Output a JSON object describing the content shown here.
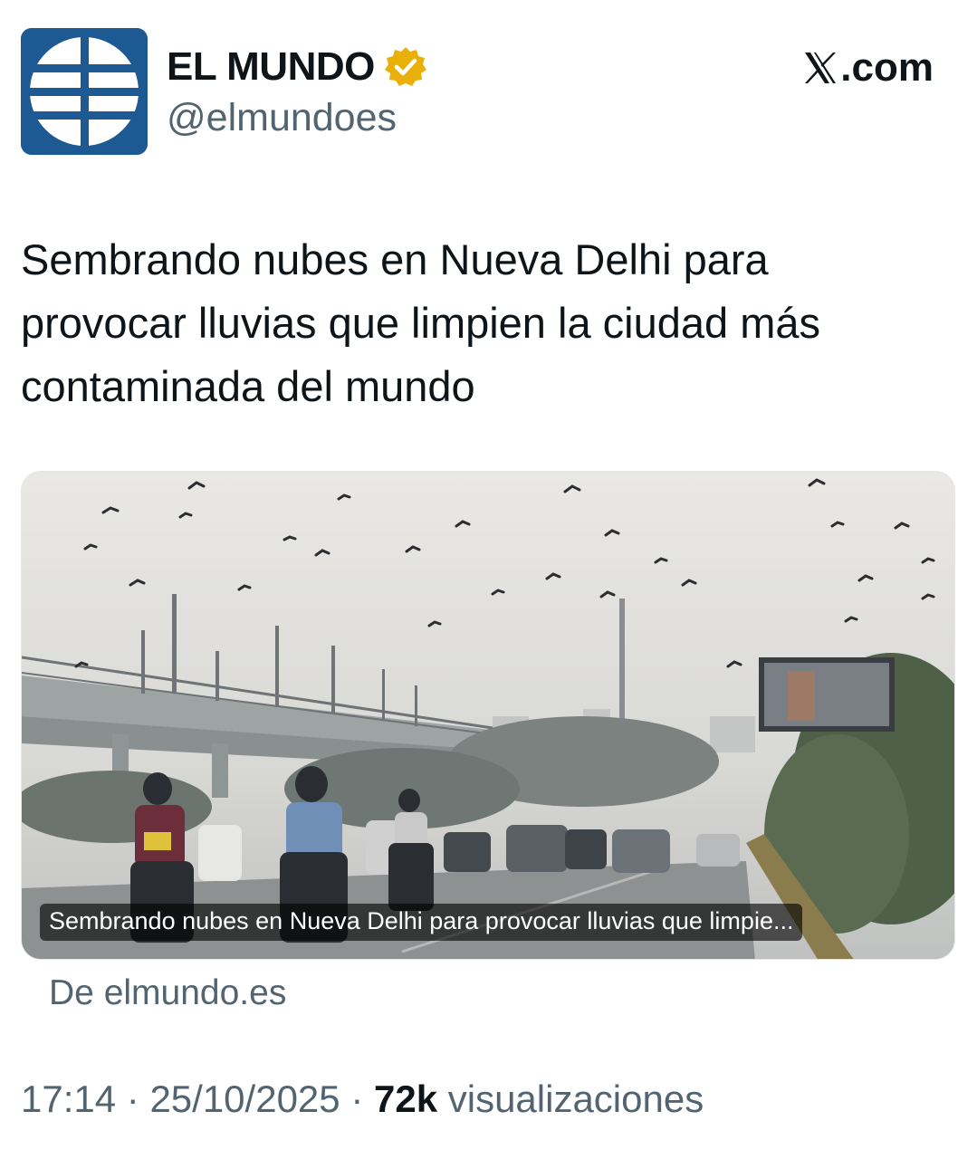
{
  "account": {
    "name": "EL MUNDO",
    "handle": "@elmundoes",
    "avatar_icon": "el-mundo-globe-logo",
    "verified_icon": "verified-gold-badge-icon",
    "avatar_color": "#1d5a94",
    "badge_color": "#e8b008"
  },
  "site": {
    "label": ".com",
    "logo_icon": "x-logo-icon"
  },
  "tweet": {
    "text": "Sembrando nubes en Nueva Delhi para provocar lluvias que limpien la ciudad más contaminada del mundo"
  },
  "card": {
    "caption": "Sembrando nubes en Nueva Delhi para provocar lluvias que limpie...",
    "source": "De elmundo.es"
  },
  "meta": {
    "time": "17:14",
    "separator": " · ",
    "date": "25/10/2025",
    "views_count": "72k",
    "views_label": " visualizaciones"
  }
}
